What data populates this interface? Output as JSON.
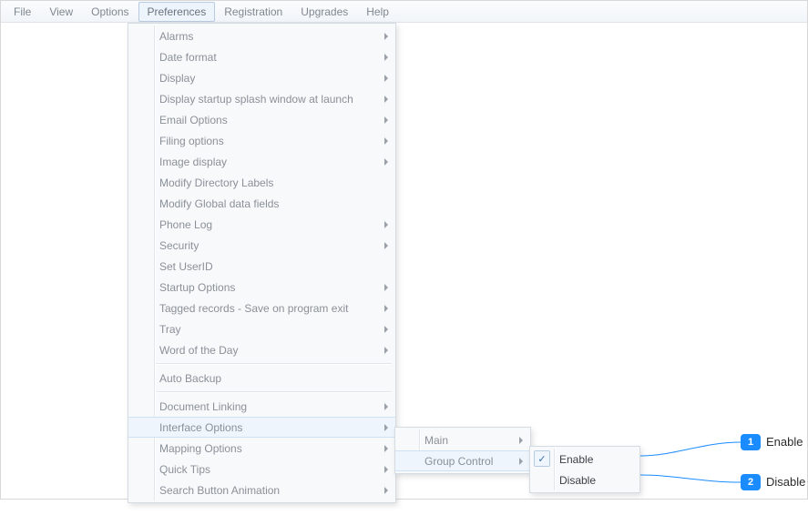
{
  "menubar": {
    "items": [
      "File",
      "View",
      "Options",
      "Preferences",
      "Registration",
      "Upgrades",
      "Help"
    ],
    "active_index": 3
  },
  "prefs_menu": {
    "groups": [
      [
        {
          "label": "Alarms",
          "submenu": true
        },
        {
          "label": "Date format",
          "submenu": true
        },
        {
          "label": "Display",
          "submenu": true
        },
        {
          "label": "Display startup splash window at launch",
          "submenu": true
        },
        {
          "label": "Email Options",
          "submenu": true
        },
        {
          "label": "Filing options",
          "submenu": true
        },
        {
          "label": "Image display",
          "submenu": true
        },
        {
          "label": "Modify Directory Labels",
          "submenu": false
        },
        {
          "label": "Modify Global data fields",
          "submenu": false
        },
        {
          "label": "Phone Log",
          "submenu": true
        },
        {
          "label": "Security",
          "submenu": true
        },
        {
          "label": "Set UserID",
          "submenu": false
        },
        {
          "label": "Startup Options",
          "submenu": true
        },
        {
          "label": "Tagged records - Save on program exit",
          "submenu": true
        },
        {
          "label": "Tray",
          "submenu": true
        },
        {
          "label": "Word of the Day",
          "submenu": true
        }
      ],
      [
        {
          "label": "Auto Backup",
          "submenu": false
        }
      ],
      [
        {
          "label": "Document Linking",
          "submenu": true
        },
        {
          "label": "Interface Options",
          "submenu": true,
          "hover": true
        },
        {
          "label": "Mapping Options",
          "submenu": true
        },
        {
          "label": "Quick Tips",
          "submenu": true
        },
        {
          "label": "Search Button Animation",
          "submenu": true
        }
      ]
    ]
  },
  "sub1": {
    "items": [
      {
        "label": "Main",
        "submenu": true
      },
      {
        "label": "Group Control",
        "submenu": true,
        "hover": true
      }
    ]
  },
  "sub2": {
    "items": [
      {
        "label": "Enable",
        "checked": true
      },
      {
        "label": "Disable",
        "checked": false
      }
    ]
  },
  "callouts": [
    {
      "num": "1",
      "label": "Enable"
    },
    {
      "num": "2",
      "label": "Disable"
    }
  ]
}
